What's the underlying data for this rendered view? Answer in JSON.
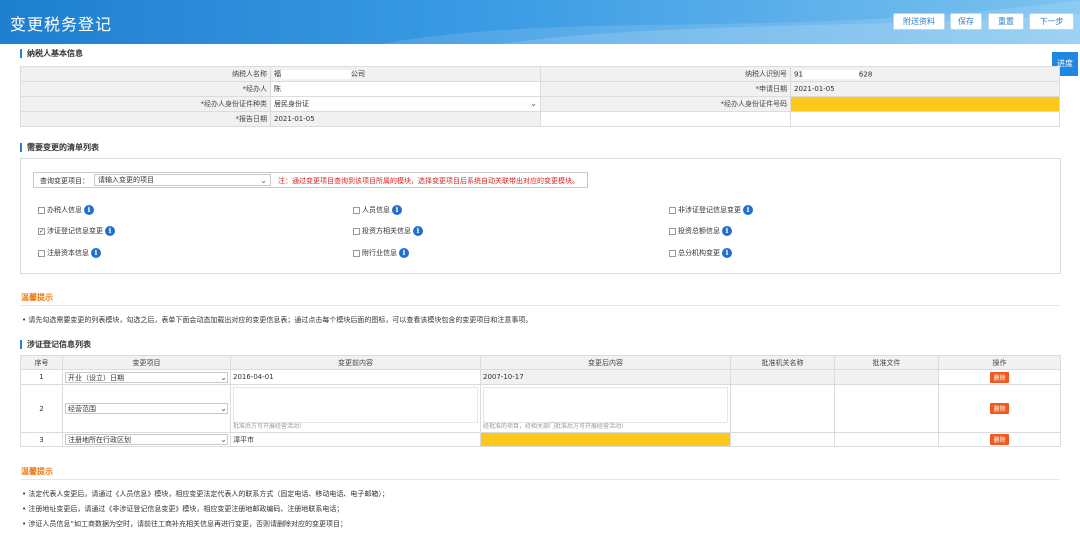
{
  "header": {
    "title": "变更税务登记",
    "buttons": [
      "附送资料",
      "保存",
      "重置",
      "下一步"
    ]
  },
  "progress_button": "进度",
  "basic_info": {
    "section_title": "纳税人基本信息",
    "taxpayer_name_label": "纳税人名称",
    "taxpayer_name_prefix": "福",
    "taxpayer_name_suffix": "公司",
    "taxpayer_id_label": "纳税人识别号",
    "taxpayer_id_prefix": "91",
    "taxpayer_id_suffix": "628",
    "agent_label": "*经办人",
    "agent_value": "陈",
    "apply_date_label": "*申请日期",
    "apply_date_value": "2021-01-05",
    "id_type_label": "*经办人身份证件种类",
    "id_type_value": "居民身份证",
    "id_number_label": "*经办人身份证件号码",
    "report_date_label": "*报告日期",
    "report_date_value": "2021-01-05"
  },
  "change_list": {
    "section_title": "需要变更的清单列表",
    "query_label": "查询变更项目：",
    "query_placeholder": "请输入变更的项目",
    "query_note": "注：通过变更项目查询到该项目所属的模块，选择变更项目后系统自动关联带出对应的变更模块。",
    "items": [
      {
        "label": "办税人信息",
        "checked": false
      },
      {
        "label": "人员信息",
        "checked": false
      },
      {
        "label": "非涉证登记信息变更",
        "checked": false
      },
      {
        "label": "涉证登记信息变更",
        "checked": true
      },
      {
        "label": "投资方相关信息",
        "checked": false
      },
      {
        "label": "投资总额信息",
        "checked": false
      },
      {
        "label": "注册资本信息",
        "checked": false
      },
      {
        "label": "附行业信息",
        "checked": false
      },
      {
        "label": "总分机构变更",
        "checked": false
      }
    ]
  },
  "tip1": {
    "title": "温馨提示",
    "text": "请先勾选需要变更的列表模块，勾选之后，表单下面会动态加载出对应的变更信息表；通过点击每个模块后面的图标，可以查看该模块包含的变更项目和注意事项。"
  },
  "cert_change": {
    "section_title": "涉证登记信息列表",
    "headers": [
      "序号",
      "变更项目",
      "变更前内容",
      "变更后内容",
      "批准机关名称",
      "批准文件",
      "操作"
    ],
    "rows": [
      {
        "no": "1",
        "item": "开业（设立）日期",
        "before": "2016-04-01",
        "after": "2007-10-17",
        "op": "删除"
      },
      {
        "no": "2",
        "item": "经营范围",
        "before_tail": "批准后方可开展经营活动）",
        "after_tail": "经批准的项目，经相关部门批准后方可开展经营活动）",
        "op": "删除"
      },
      {
        "no": "3",
        "item": "注册地所在行政区划",
        "before": "漳平市",
        "after": "",
        "op": "删除"
      }
    ]
  },
  "tip2": {
    "title": "温馨提示",
    "lines": [
      "法定代表人变更后，请通过《人员信息》模块，相应变更法定代表人的联系方式（固定电话、移动电话、电子邮箱）；",
      "注册地址变更后，请通过《非涉证登记信息变更》模块，相应变更注册地邮政编码、注册地联系电话；",
      "涉证人员信息”如工商数据为空时，请前往工商补充相关信息再进行变更，否则请删除对应的变更项目；"
    ]
  },
  "colors": {
    "accent": "#2a7fcf",
    "header": "#1f7fd0",
    "required_yellow": "#fcc81b",
    "delete": "#f25a1d",
    "tip": "#f07a12"
  }
}
